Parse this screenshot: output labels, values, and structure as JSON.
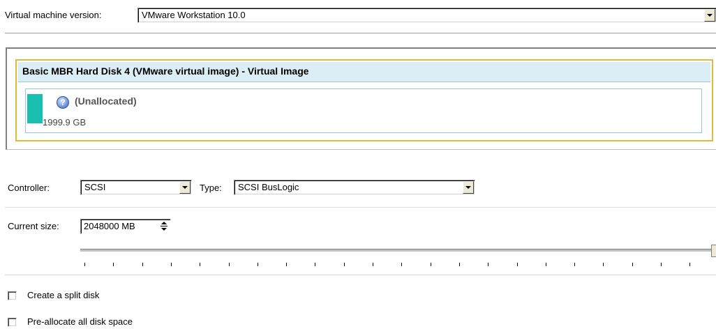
{
  "vm_version": {
    "label": "Virtual machine version:",
    "value": "VMware Workstation 10.0"
  },
  "disk": {
    "title": "Basic MBR Hard Disk 4 (VMware virtual image) - Virtual Image",
    "partition": {
      "name": "(Unallocated)",
      "size": "1999.9 GB",
      "icon": "question-icon",
      "color": "#19c0b0"
    },
    "highlight_color": "#e0b93d"
  },
  "controller": {
    "label": "Controller:",
    "value": "SCSI"
  },
  "type": {
    "label": "Type:",
    "value": "SCSI BusLogic"
  },
  "current_size": {
    "label": "Current size:",
    "value": "2048000 MB",
    "slider_fraction": 1.0
  },
  "options": {
    "split_disk": {
      "label": "Create a split disk",
      "checked": false
    },
    "preallocate": {
      "label": "Pre-allocate all disk space",
      "checked": false
    }
  }
}
